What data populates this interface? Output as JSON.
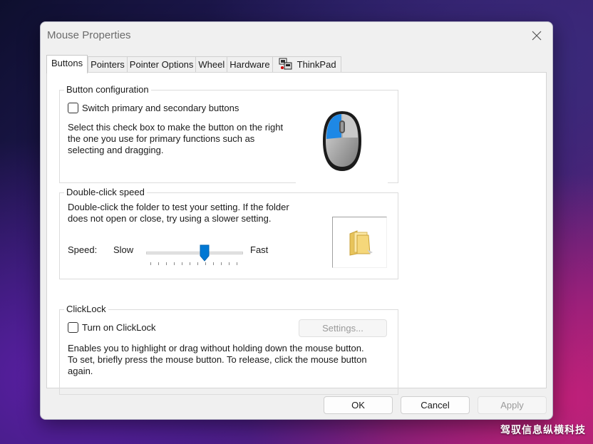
{
  "window": {
    "title": "Mouse Properties",
    "close_icon": "close-icon"
  },
  "tabs": [
    {
      "label": "Buttons",
      "active": true
    },
    {
      "label": "Pointers"
    },
    {
      "label": "Pointer Options"
    },
    {
      "label": "Wheel"
    },
    {
      "label": "Hardware"
    },
    {
      "label": "ThinkPad",
      "icon": "thinkpad-icon"
    }
  ],
  "button_configuration": {
    "group_label": "Button configuration",
    "checkbox_label": "Switch primary and secondary buttons",
    "checked": false,
    "description_line1": "Select this check box to make the button on the right",
    "description_line2": "the one you use for primary functions such as",
    "description_line3": "selecting and dragging.",
    "image_icon": "mouse-icon"
  },
  "double_click_speed": {
    "group_label": "Double-click speed",
    "description_line1": "Double-click the folder to test your setting. If the folder",
    "description_line2": "does not open or close, try using a slower setting.",
    "speed_label": "Speed:",
    "slow_label": "Slow",
    "fast_label": "Fast",
    "slider_value_fraction": 0.6,
    "folder_icon": "folder-icon"
  },
  "clicklock": {
    "group_label": "ClickLock",
    "checkbox_label": "Turn on ClickLock",
    "checked": false,
    "settings_button": "Settings...",
    "description_line1": "Enables you to highlight or drag without holding down the mouse button.",
    "description_line2": "To set, briefly press the mouse button. To release, click the mouse button",
    "description_line3": "again."
  },
  "footer": {
    "ok_label": "OK",
    "cancel_label": "Cancel",
    "apply_label": "Apply"
  },
  "colors": {
    "accent": "#0078d4",
    "mouse_highlight": "#1e88e5"
  },
  "watermark": "驾驭信息纵横科技"
}
